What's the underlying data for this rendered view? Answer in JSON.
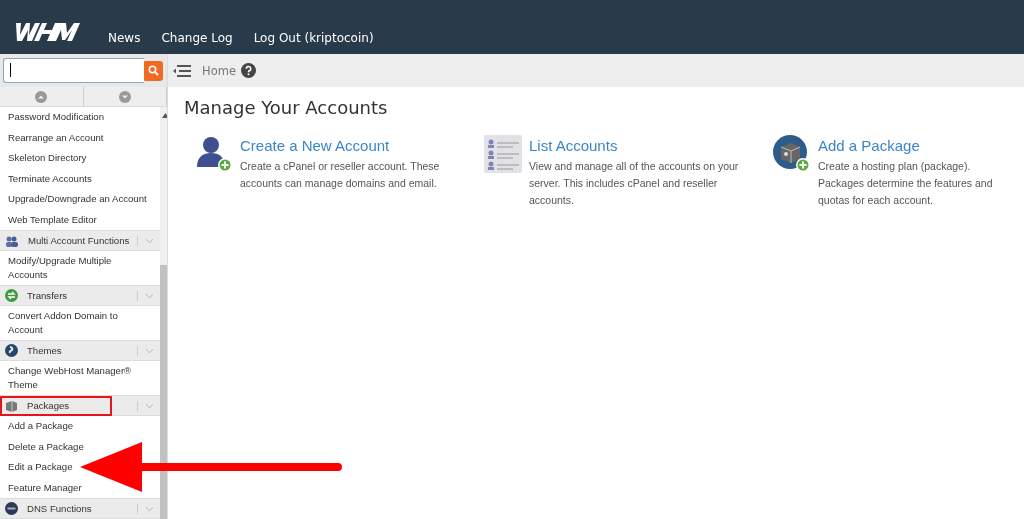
{
  "header": {
    "nav": [
      "News",
      "Change Log",
      "Log Out (kriptocoin)"
    ]
  },
  "breadcrumb": {
    "label": "Home"
  },
  "sidebar": {
    "items": [
      {
        "kind": "item",
        "label": "Password Modification"
      },
      {
        "kind": "item",
        "label": "Rearrange an Account"
      },
      {
        "kind": "item",
        "label": "Skeleton Directory"
      },
      {
        "kind": "item",
        "label": "Terminate Accounts"
      },
      {
        "kind": "item",
        "label": "Upgrade/Downgrade an Account"
      },
      {
        "kind": "item",
        "label": "Web Template Editor"
      },
      {
        "kind": "section",
        "label": "Multi Account Functions",
        "highlighted": false
      },
      {
        "kind": "item",
        "label": "Modify/Upgrade Multiple Accounts"
      },
      {
        "kind": "section",
        "label": "Transfers",
        "highlighted": false
      },
      {
        "kind": "item",
        "label": "Convert Addon Domain to Account"
      },
      {
        "kind": "section",
        "label": "Themes",
        "highlighted": false
      },
      {
        "kind": "item",
        "label": "Change WebHost Manager® Theme"
      },
      {
        "kind": "section",
        "label": "Packages",
        "highlighted": true
      },
      {
        "kind": "item",
        "label": "Add a Package"
      },
      {
        "kind": "item",
        "label": "Delete a Package"
      },
      {
        "kind": "item",
        "label": "Edit a Package"
      },
      {
        "kind": "item",
        "label": "Feature Manager"
      },
      {
        "kind": "section",
        "label": "DNS Functions",
        "highlighted": false
      }
    ]
  },
  "main": {
    "title": "Manage Your Accounts",
    "cards": [
      {
        "title": "Create a New Account",
        "description": "Create a cPanel or reseller account. These accounts can manage domains and email."
      },
      {
        "title": "List Accounts",
        "description": "View and manage all of the accounts on your server. This includes cPanel and reseller accounts."
      },
      {
        "title": "Add a Package",
        "description": "Create a hosting plan (package). Packages determine the features and quotas for each account."
      }
    ]
  }
}
